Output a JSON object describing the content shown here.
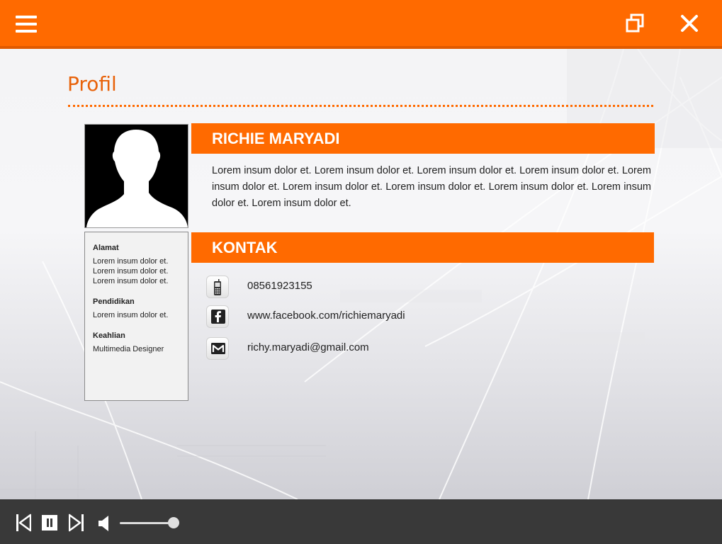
{
  "window": {
    "menu_icon": "hamburger-menu-icon",
    "restore_icon": "window-restore-icon",
    "close_icon": "close-icon",
    "accent_color": "#ff6a00"
  },
  "page": {
    "title": "Profil"
  },
  "profile": {
    "photo": "silhouette-avatar",
    "sidebar": {
      "address_heading": "Alamat",
      "address_lines": [
        "Lorem insum dolor et.",
        "Lorem insum dolor et.",
        "Lorem insum dolor et."
      ],
      "education_heading": "Pendidikan",
      "education_lines": [
        "Lorem insum dolor et."
      ],
      "skills_heading": "Keahlian",
      "skills_lines": [
        "Multimedia Designer"
      ]
    },
    "name": "RICHIE MARYADI",
    "bio": "Lorem insum dolor et. Lorem insum dolor et. Lorem insum dolor et. Lorem insum dolor et. Lorem insum dolor et. Lorem insum dolor et. Lorem insum dolor et. Lorem insum dolor et. Lorem insum dolor et. Lorem insum dolor et."
  },
  "contact": {
    "heading": "KONTAK",
    "items": [
      {
        "icon": "mobile-phone-icon",
        "text": "08561923155"
      },
      {
        "icon": "facebook-icon",
        "text": "www.facebook.com/richiemaryadi"
      },
      {
        "icon": "gmail-icon",
        "text": "richy.maryadi@gmail.com"
      }
    ]
  },
  "player": {
    "prev_icon": "skip-previous-icon",
    "pause_icon": "pause-icon",
    "next_icon": "skip-next-icon",
    "volume_icon": "speaker-icon",
    "volume_level": 0.9
  }
}
